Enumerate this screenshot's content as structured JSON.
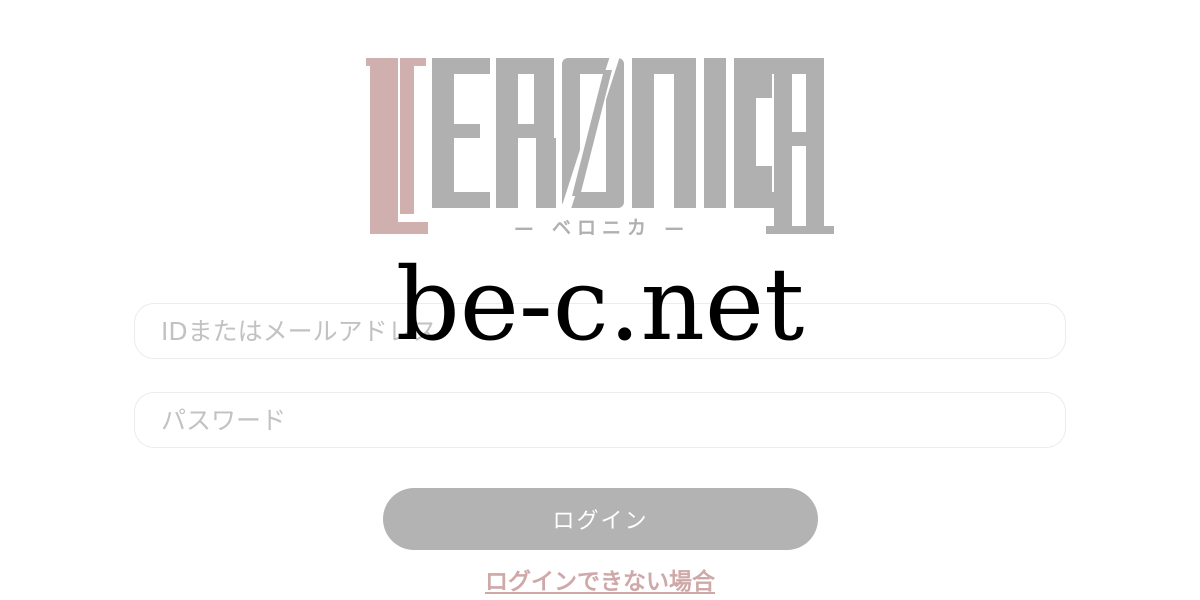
{
  "logo": {
    "text": "VERONICA",
    "subtitle": "— ベロニカ —",
    "accent_color": "#d0afaf",
    "text_color": "#b0b0b0"
  },
  "watermark": {
    "text": "be-c.net"
  },
  "form": {
    "id_field": {
      "placeholder": "IDまたはメールアドレス",
      "value": ""
    },
    "password_field": {
      "placeholder": "パスワード",
      "value": ""
    },
    "login_button_label": "ログイン",
    "help_link_label": "ログインできない場合"
  },
  "colors": {
    "button_bg": "#b3b3b3",
    "link": "#cfa8a8",
    "input_border": "#ececec"
  }
}
